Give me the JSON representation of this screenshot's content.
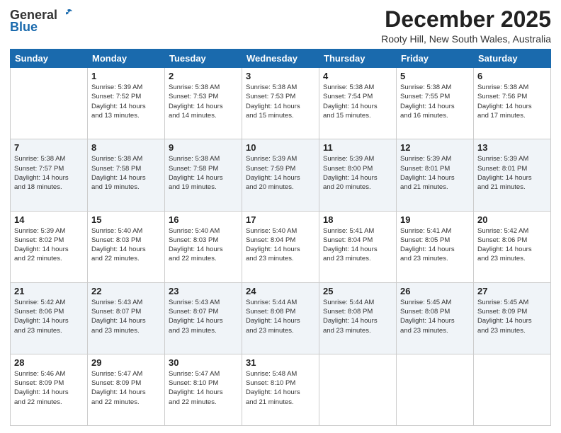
{
  "logo": {
    "general": "General",
    "blue": "Blue"
  },
  "header": {
    "month": "December 2025",
    "location": "Rooty Hill, New South Wales, Australia"
  },
  "weekdays": [
    "Sunday",
    "Monday",
    "Tuesday",
    "Wednesday",
    "Thursday",
    "Friday",
    "Saturday"
  ],
  "weeks": [
    [
      {
        "day": "",
        "info": ""
      },
      {
        "day": "1",
        "info": "Sunrise: 5:39 AM\nSunset: 7:52 PM\nDaylight: 14 hours\nand 13 minutes."
      },
      {
        "day": "2",
        "info": "Sunrise: 5:38 AM\nSunset: 7:53 PM\nDaylight: 14 hours\nand 14 minutes."
      },
      {
        "day": "3",
        "info": "Sunrise: 5:38 AM\nSunset: 7:53 PM\nDaylight: 14 hours\nand 15 minutes."
      },
      {
        "day": "4",
        "info": "Sunrise: 5:38 AM\nSunset: 7:54 PM\nDaylight: 14 hours\nand 15 minutes."
      },
      {
        "day": "5",
        "info": "Sunrise: 5:38 AM\nSunset: 7:55 PM\nDaylight: 14 hours\nand 16 minutes."
      },
      {
        "day": "6",
        "info": "Sunrise: 5:38 AM\nSunset: 7:56 PM\nDaylight: 14 hours\nand 17 minutes."
      }
    ],
    [
      {
        "day": "7",
        "info": "Sunrise: 5:38 AM\nSunset: 7:57 PM\nDaylight: 14 hours\nand 18 minutes."
      },
      {
        "day": "8",
        "info": "Sunrise: 5:38 AM\nSunset: 7:58 PM\nDaylight: 14 hours\nand 19 minutes."
      },
      {
        "day": "9",
        "info": "Sunrise: 5:38 AM\nSunset: 7:58 PM\nDaylight: 14 hours\nand 19 minutes."
      },
      {
        "day": "10",
        "info": "Sunrise: 5:39 AM\nSunset: 7:59 PM\nDaylight: 14 hours\nand 20 minutes."
      },
      {
        "day": "11",
        "info": "Sunrise: 5:39 AM\nSunset: 8:00 PM\nDaylight: 14 hours\nand 20 minutes."
      },
      {
        "day": "12",
        "info": "Sunrise: 5:39 AM\nSunset: 8:01 PM\nDaylight: 14 hours\nand 21 minutes."
      },
      {
        "day": "13",
        "info": "Sunrise: 5:39 AM\nSunset: 8:01 PM\nDaylight: 14 hours\nand 21 minutes."
      }
    ],
    [
      {
        "day": "14",
        "info": "Sunrise: 5:39 AM\nSunset: 8:02 PM\nDaylight: 14 hours\nand 22 minutes."
      },
      {
        "day": "15",
        "info": "Sunrise: 5:40 AM\nSunset: 8:03 PM\nDaylight: 14 hours\nand 22 minutes."
      },
      {
        "day": "16",
        "info": "Sunrise: 5:40 AM\nSunset: 8:03 PM\nDaylight: 14 hours\nand 22 minutes."
      },
      {
        "day": "17",
        "info": "Sunrise: 5:40 AM\nSunset: 8:04 PM\nDaylight: 14 hours\nand 23 minutes."
      },
      {
        "day": "18",
        "info": "Sunrise: 5:41 AM\nSunset: 8:04 PM\nDaylight: 14 hours\nand 23 minutes."
      },
      {
        "day": "19",
        "info": "Sunrise: 5:41 AM\nSunset: 8:05 PM\nDaylight: 14 hours\nand 23 minutes."
      },
      {
        "day": "20",
        "info": "Sunrise: 5:42 AM\nSunset: 8:06 PM\nDaylight: 14 hours\nand 23 minutes."
      }
    ],
    [
      {
        "day": "21",
        "info": "Sunrise: 5:42 AM\nSunset: 8:06 PM\nDaylight: 14 hours\nand 23 minutes."
      },
      {
        "day": "22",
        "info": "Sunrise: 5:43 AM\nSunset: 8:07 PM\nDaylight: 14 hours\nand 23 minutes."
      },
      {
        "day": "23",
        "info": "Sunrise: 5:43 AM\nSunset: 8:07 PM\nDaylight: 14 hours\nand 23 minutes."
      },
      {
        "day": "24",
        "info": "Sunrise: 5:44 AM\nSunset: 8:08 PM\nDaylight: 14 hours\nand 23 minutes."
      },
      {
        "day": "25",
        "info": "Sunrise: 5:44 AM\nSunset: 8:08 PM\nDaylight: 14 hours\nand 23 minutes."
      },
      {
        "day": "26",
        "info": "Sunrise: 5:45 AM\nSunset: 8:08 PM\nDaylight: 14 hours\nand 23 minutes."
      },
      {
        "day": "27",
        "info": "Sunrise: 5:45 AM\nSunset: 8:09 PM\nDaylight: 14 hours\nand 23 minutes."
      }
    ],
    [
      {
        "day": "28",
        "info": "Sunrise: 5:46 AM\nSunset: 8:09 PM\nDaylight: 14 hours\nand 22 minutes."
      },
      {
        "day": "29",
        "info": "Sunrise: 5:47 AM\nSunset: 8:09 PM\nDaylight: 14 hours\nand 22 minutes."
      },
      {
        "day": "30",
        "info": "Sunrise: 5:47 AM\nSunset: 8:10 PM\nDaylight: 14 hours\nand 22 minutes."
      },
      {
        "day": "31",
        "info": "Sunrise: 5:48 AM\nSunset: 8:10 PM\nDaylight: 14 hours\nand 21 minutes."
      },
      {
        "day": "",
        "info": ""
      },
      {
        "day": "",
        "info": ""
      },
      {
        "day": "",
        "info": ""
      }
    ]
  ]
}
